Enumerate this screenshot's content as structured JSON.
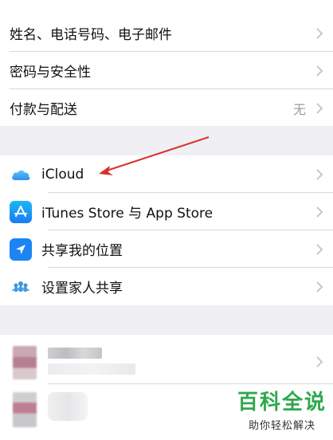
{
  "account_section": {
    "items": [
      {
        "label": "姓名、电话号码、电子邮件"
      },
      {
        "label": "密码与安全性"
      },
      {
        "label": "付款与配送",
        "value": "无"
      }
    ]
  },
  "services_section": {
    "items": [
      {
        "label": "iCloud",
        "icon": "icloud-icon"
      },
      {
        "label": "iTunes Store 与 App Store",
        "icon": "app-store-icon"
      },
      {
        "label": "共享我的位置",
        "icon": "location-arrow-icon"
      },
      {
        "label": "设置家人共享",
        "icon": "family-sharing-icon"
      }
    ]
  },
  "colors": {
    "background": "#efeff4",
    "annotation_arrow": "#d9312a",
    "watermark_green": "#2fa84f"
  },
  "watermark": {
    "title": "百科全说",
    "subtitle": "助你轻松解决"
  }
}
